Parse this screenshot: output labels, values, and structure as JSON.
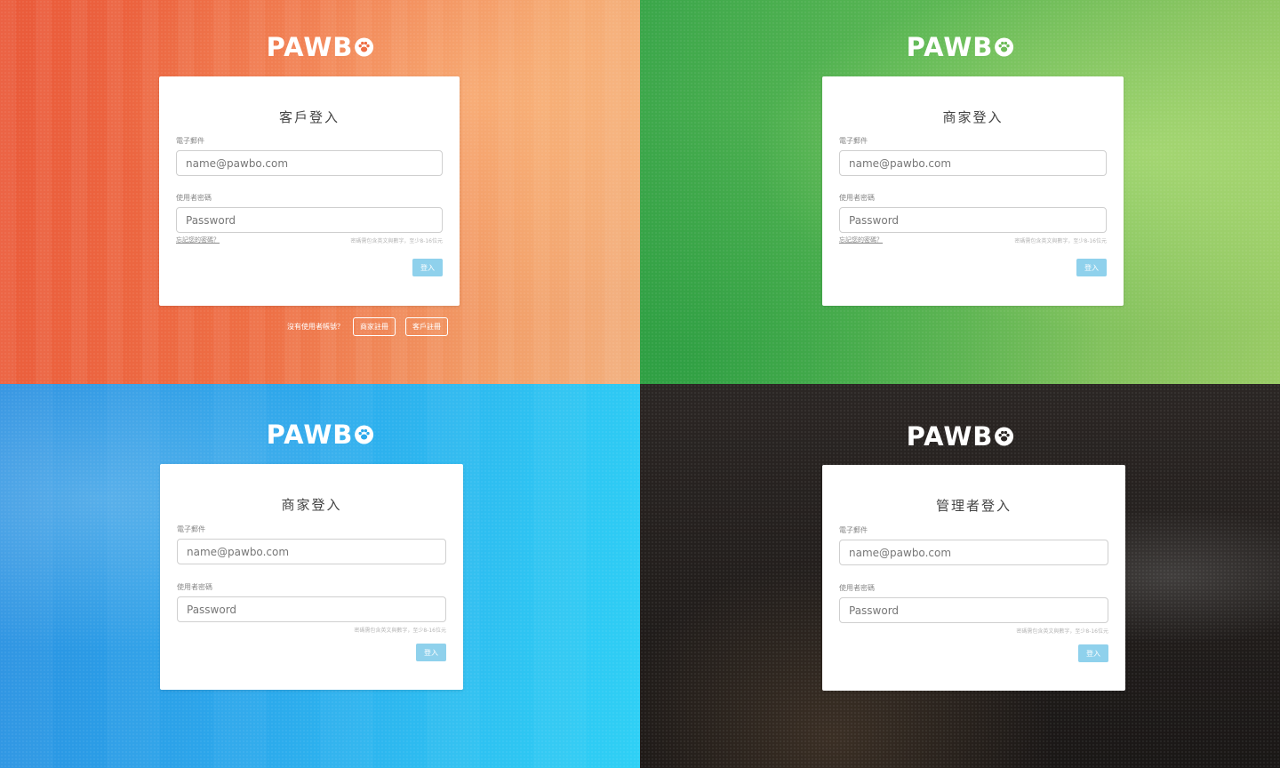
{
  "brand": "PAWB",
  "colors": {
    "orange_panel": "#ee6f45",
    "green_panel": "#5cb754",
    "blue_panel": "#2ca9ec",
    "dark_panel": "#221e1c",
    "login_button": "#8fd1ec"
  },
  "icons": [
    "paw-icon"
  ],
  "panels": [
    {
      "title": "客戶登入",
      "email_label": "電子郵件",
      "email_placeholder": "name@pawbo.com",
      "password_label": "使用者密碼",
      "password_placeholder": "Password",
      "forgot_link": "忘記您的密碼？",
      "password_hint": "密碼需包含英文與數字，至少8-16位元",
      "login_button": "登入",
      "signup_prompt": "沒有使用者帳號？",
      "merchant_signup": "商家註冊",
      "customer_signup": "客戶註冊"
    },
    {
      "title": "商家登入",
      "email_label": "電子郵件",
      "email_placeholder": "name@pawbo.com",
      "password_label": "使用者密碼",
      "password_placeholder": "Password",
      "forgot_link": "忘記您的密碼？",
      "password_hint": "密碼需包含英文與數字，至少8-16位元",
      "login_button": "登入"
    },
    {
      "title": "商家登入",
      "email_label": "電子郵件",
      "email_placeholder": "name@pawbo.com",
      "password_label": "使用者密碼",
      "password_placeholder": "Password",
      "password_hint": "密碼需包含英文與數字，至少8-16位元",
      "login_button": "登入"
    },
    {
      "title": "管理者登入",
      "email_label": "電子郵件",
      "email_placeholder": "name@pawbo.com",
      "password_label": "使用者密碼",
      "password_placeholder": "Password",
      "password_hint": "密碼需包含英文與數字，至少8-16位元",
      "login_button": "登入"
    }
  ]
}
